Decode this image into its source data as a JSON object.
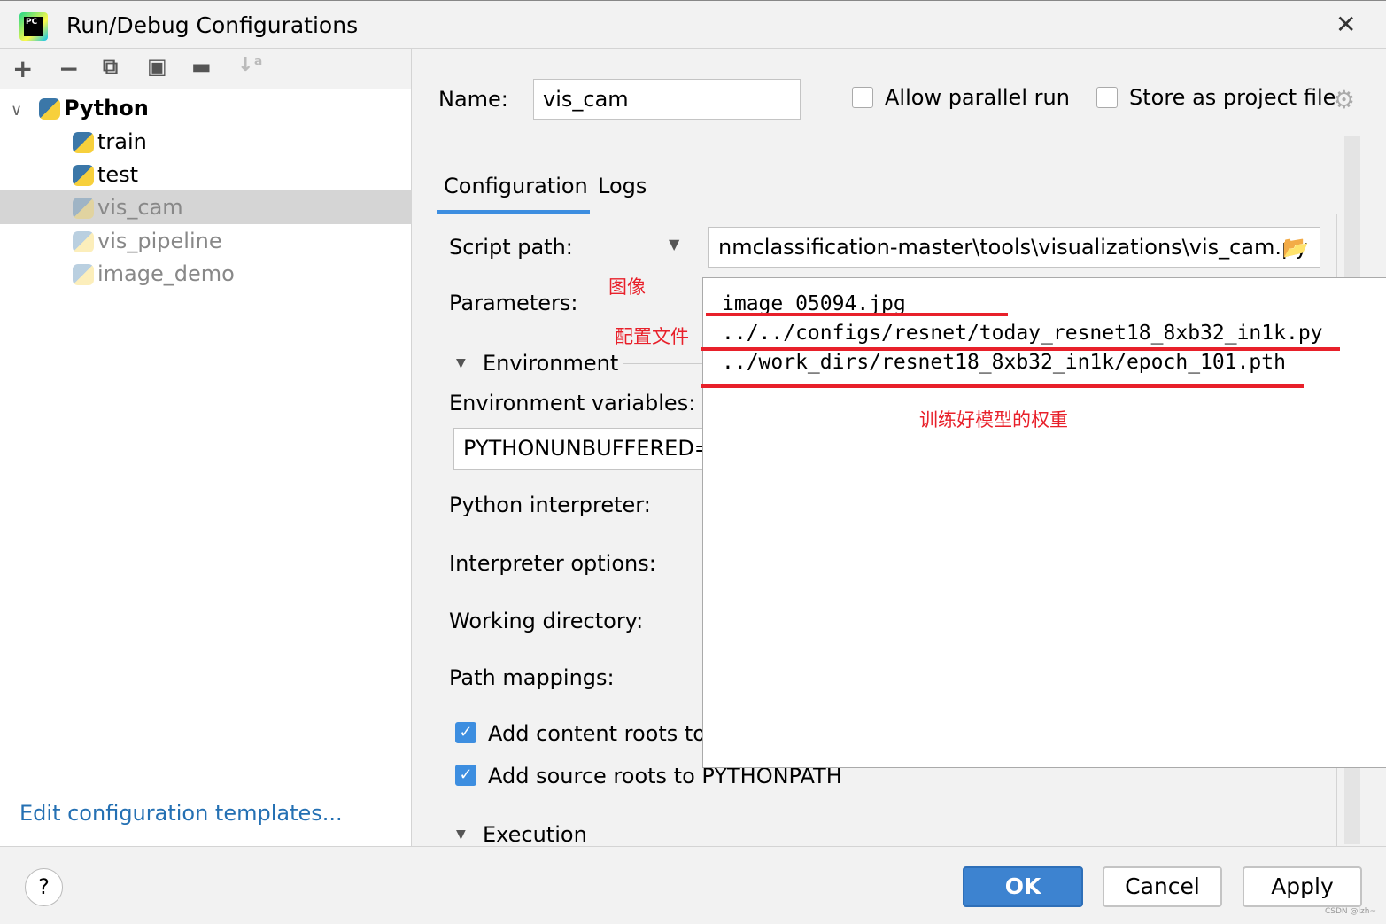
{
  "window": {
    "title": "Run/Debug Configurations",
    "close_icon": "close-icon",
    "logo": "PC"
  },
  "toolbar": {
    "icons": [
      "plus-icon",
      "minus-icon",
      "copy-icon",
      "save-icon",
      "new-folder-icon",
      "sort-alpha-icon"
    ]
  },
  "tree": {
    "root": "Python",
    "items": [
      {
        "label": "train",
        "faded": false
      },
      {
        "label": "test",
        "faded": false
      },
      {
        "label": "vis_cam",
        "faded": true,
        "selected": true
      },
      {
        "label": "vis_pipeline",
        "faded": true
      },
      {
        "label": "image_demo",
        "faded": true
      }
    ]
  },
  "edit_templates": "Edit configuration templates...",
  "form": {
    "name_label": "Name:",
    "name_value": "vis_cam",
    "allow_parallel": "Allow parallel run",
    "allow_parallel_checked": false,
    "store_project": "Store as project file",
    "store_project_checked": false,
    "tabs": [
      {
        "label": "Configuration",
        "active": true
      },
      {
        "label": "Logs",
        "active": false
      }
    ],
    "script_path_label": "Script path:",
    "script_path_value": "nmclassification-master\\tools\\visualizations\\vis_cam.py",
    "parameters_label": "Parameters:",
    "environment_label": "Environment",
    "env_vars_label": "Environment variables:",
    "env_vars_value": "PYTHONUNBUFFERED=",
    "interpreter_label": "Python interpreter:",
    "interp_options_label": "Interpreter options:",
    "working_dir_label": "Working directory:",
    "path_mappings_label": "Path mappings:",
    "content_roots": "Add content roots to",
    "content_roots_checked": true,
    "source_roots": "Add source roots to PYTHONPATH",
    "source_roots_checked": true,
    "execution_label": "Execution"
  },
  "params_popup": {
    "lines": [
      "image_05094.jpg",
      "../../configs/resnet/today_resnet18_8xb32_in1k.py",
      "../work_dirs/resnet18_8xb32_in1k/epoch_101.pth"
    ]
  },
  "annotations": {
    "image": "图像",
    "config": "配置文件",
    "weights": "训练好模型的权重",
    "color": "#e8202a"
  },
  "footer": {
    "help": "?",
    "ok": "OK",
    "cancel": "Cancel",
    "apply": "Apply",
    "watermark": "CSDN @lzh~"
  },
  "colors": {
    "accent": "#3d8ee0",
    "link": "#2470b3"
  }
}
